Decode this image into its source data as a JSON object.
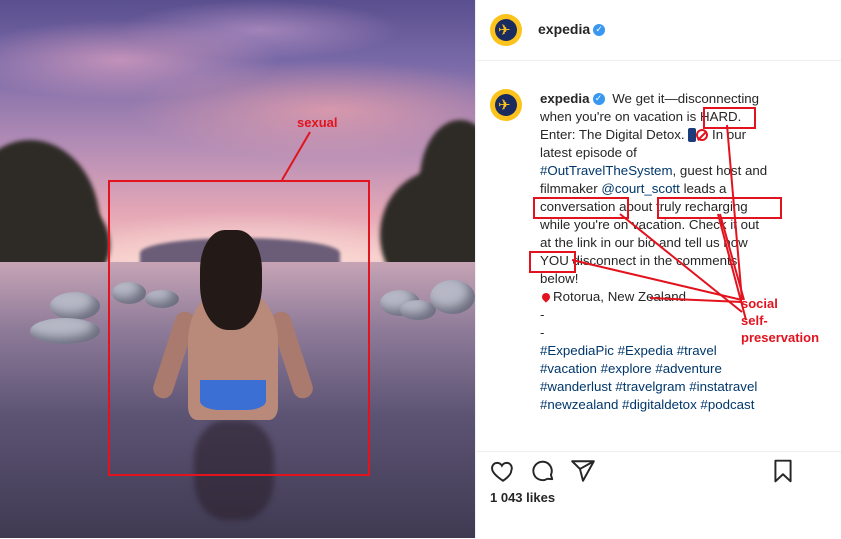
{
  "post": {
    "username": "expedia",
    "caption_lines": [
      "We get it—disconnecting",
      "when you're on vacation is HARD.",
      "Enter: The Digital Detox.",
      "In our",
      "latest episode of",
      "#OutTravelTheSystem",
      ", guest host and",
      "filmmaker",
      "@court_scott",
      "leads a",
      "conversation about truly recharging",
      "while you're on vacation. Check it out",
      "at the link in our bio and tell us how",
      "YOU disconnect in the comments",
      "below!",
      "Rotorua, New Zealand",
      "-",
      "-"
    ],
    "hashtag_lines": [
      "#ExpediaPic #Expedia #travel",
      "#vacation #explore #adventure",
      "#wanderlust #travelgram #instatravel",
      "#newzealand #digitaldetox #podcast"
    ],
    "likes": "1 043 likes"
  },
  "annotations": {
    "photo_label": "sexual",
    "social_label": "social",
    "selfpres_label_1": "self-",
    "selfpres_label_2": "preservation"
  },
  "colors": {
    "annotation": "#e2131e",
    "link": "#00376b",
    "brand_yellow": "#fcc31c",
    "brand_navy": "#1a2b5f",
    "verified": "#3897f0"
  },
  "icons": [
    "heart-icon",
    "comment-icon",
    "share-icon",
    "bookmark-icon",
    "verified-icon",
    "location-pin-icon",
    "phone-emoji",
    "no-entry-emoji",
    "expedia-logo"
  ]
}
